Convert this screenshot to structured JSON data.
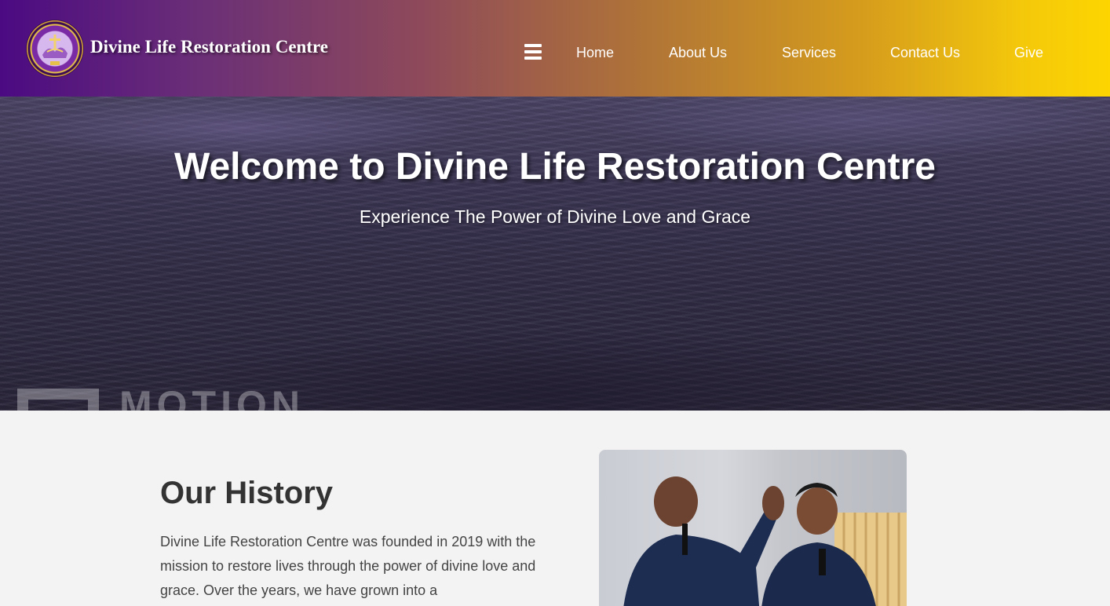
{
  "header": {
    "brand": "Divine Life Restoration Centre",
    "logo_icon": "church-seal-logo",
    "menu_icon": "hamburger-menu-icon",
    "nav": [
      {
        "label": "Home"
      },
      {
        "label": "About Us"
      },
      {
        "label": "Services"
      },
      {
        "label": "Contact Us"
      },
      {
        "label": "Give"
      }
    ],
    "gradient_colors": [
      "#4b0a82",
      "#fdd500"
    ]
  },
  "hero": {
    "title": "Welcome to Divine Life Restoration Centre",
    "subtitle": "Experience The Power of Divine Love and Grace",
    "watermark": "MOTION"
  },
  "history": {
    "title": "Our History",
    "text": "Divine Life Restoration Centre was founded in 2019 with the mission to restore lives through the power of divine love and grace. Over the years, we have grown into a"
  }
}
